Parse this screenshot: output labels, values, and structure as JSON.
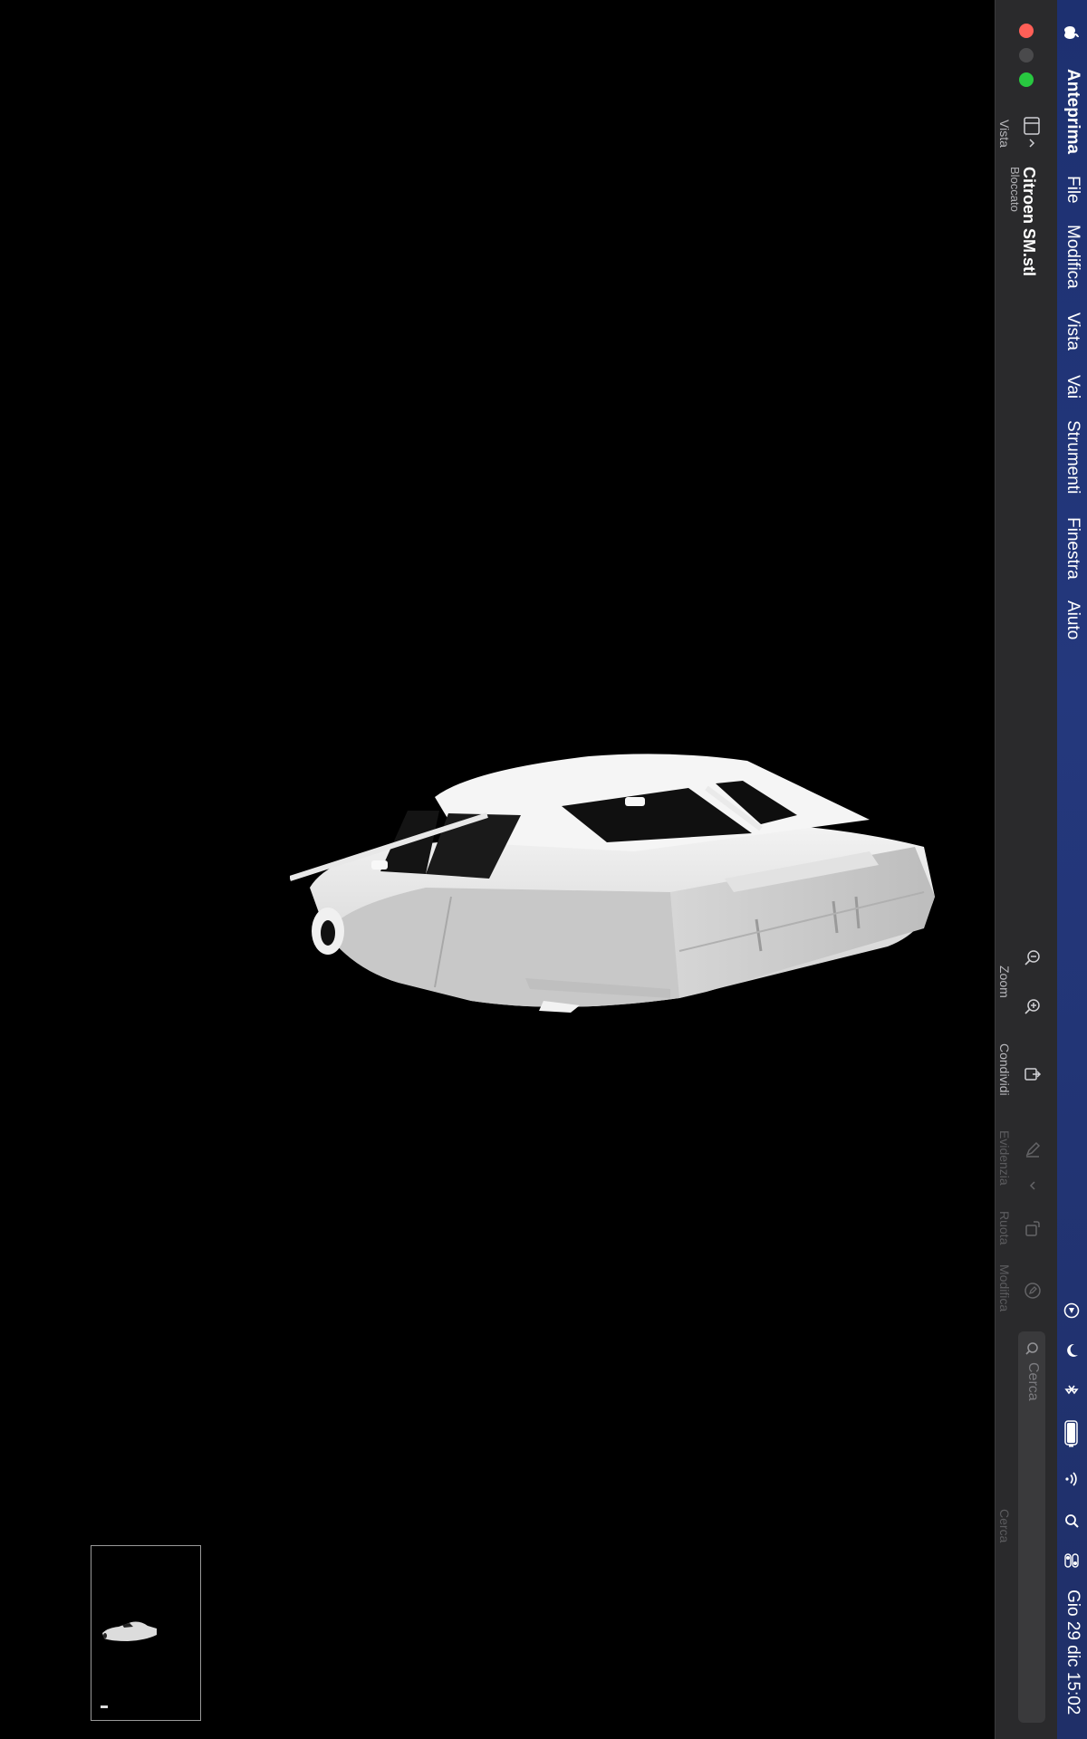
{
  "menubar": {
    "app_name": "Anteprima",
    "items": [
      "File",
      "Modifica",
      "Vista",
      "Vai",
      "Strumenti",
      "Finestra",
      "Aiuto"
    ],
    "clock": "Gio 29 dic  15:02",
    "status_icons": [
      "apple-icon",
      "play-circle-icon",
      "moon-icon",
      "bluetooth-icon",
      "battery-icon",
      "wifi-icon",
      "spotlight-icon",
      "control-center-icon"
    ]
  },
  "window": {
    "title": "Citroen SM.stl",
    "subtitle": "Bloccato",
    "sidebar_label": "Vista",
    "toolbar": {
      "zoom_label": "Zoom",
      "share_label": "Condividi",
      "highlight_label": "Evidenzia",
      "rotate_label": "Ruota",
      "markup_label": "Modifica",
      "search_placeholder": "Cerca",
      "search_label": "Cerca"
    }
  },
  "colors": {
    "close": "#ff5f57",
    "minimize": "#4a4a4c",
    "zoom": "#28c840",
    "menubar": "#24387d",
    "toolbar": "#2a2a2c",
    "model": "#e6e6e6"
  }
}
